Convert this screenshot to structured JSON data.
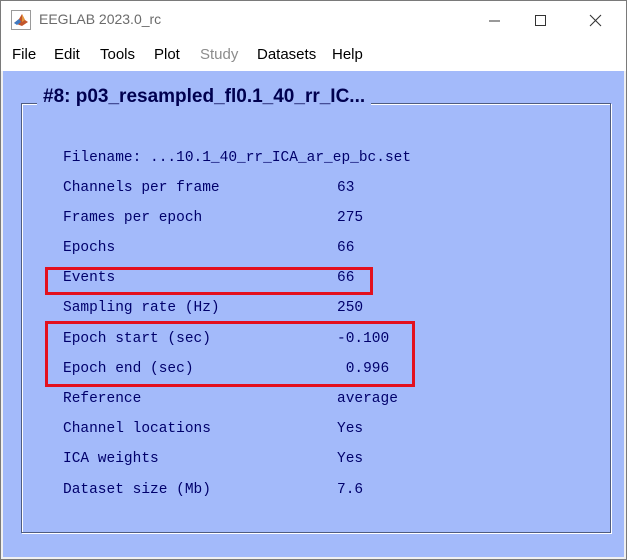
{
  "window": {
    "title": "EEGLAB 2023.0_rc",
    "icon": "matlab-icon",
    "controls": [
      "minimize-icon",
      "maximize-icon",
      "close-icon"
    ]
  },
  "menu": {
    "items": [
      {
        "label": "File",
        "enabled": true
      },
      {
        "label": "Edit",
        "enabled": true
      },
      {
        "label": "Tools",
        "enabled": true
      },
      {
        "label": "Plot",
        "enabled": true
      },
      {
        "label": "Study",
        "enabled": false
      },
      {
        "label": "Datasets",
        "enabled": true
      },
      {
        "label": "Help",
        "enabled": true
      }
    ]
  },
  "panel": {
    "title": "#8: p03_resampled_fl0.1_40_rr_IC...",
    "filename": "Filename: ...10.1_40_rr_ICA_ar_ep_bc.set",
    "rows": [
      {
        "label": "Channels per frame",
        "value": "63"
      },
      {
        "label": "Frames per epoch",
        "value": "275"
      },
      {
        "label": "Epochs",
        "value": "66"
      },
      {
        "label": "Events",
        "value": "66"
      },
      {
        "label": "Sampling rate (Hz)",
        "value": "250"
      },
      {
        "label": "Epoch start (sec)",
        "value": "-0.100"
      },
      {
        "label": "Epoch end (sec)",
        "value": " 0.996"
      },
      {
        "label": "Reference",
        "value": "average"
      },
      {
        "label": "Channel locations",
        "value": "Yes"
      },
      {
        "label": "ICA weights",
        "value": "Yes"
      },
      {
        "label": "Dataset size (Mb)",
        "value": "7.6"
      }
    ]
  },
  "colors": {
    "background": "#a3bafa",
    "text": "#00006b",
    "title": "#00004f",
    "highlight": "#e3101d"
  }
}
